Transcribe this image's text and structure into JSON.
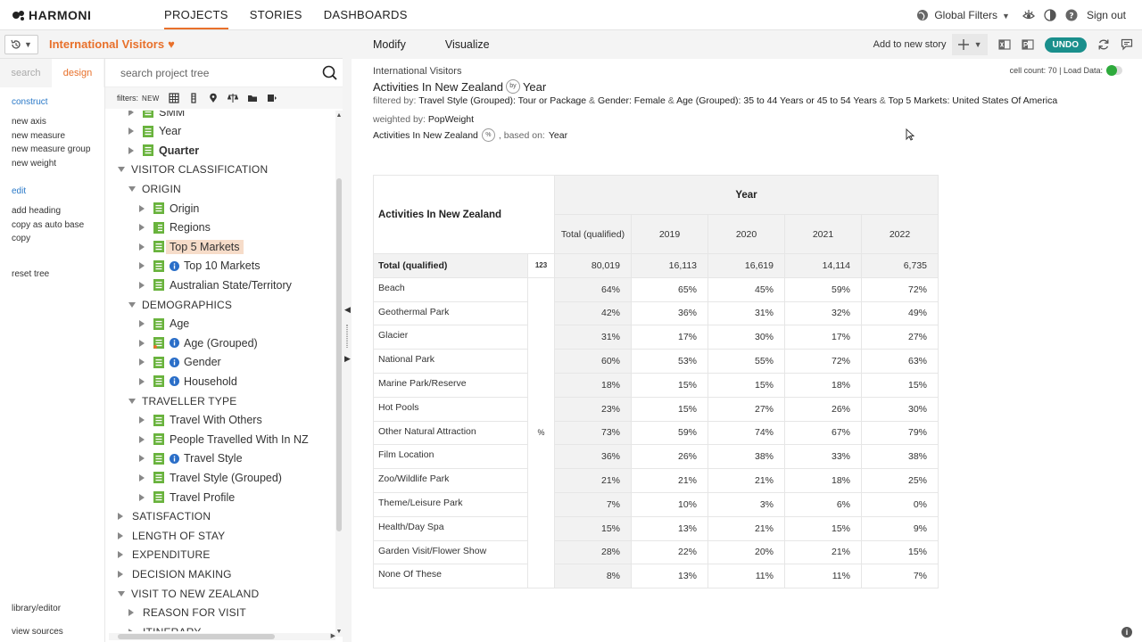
{
  "brand": {
    "name": "HARMONI",
    "accent": "#e8702a",
    "teal": "#1a8f8c"
  },
  "nav": {
    "tabs": [
      {
        "label": "PROJECTS",
        "active": true
      },
      {
        "label": "STORIES",
        "active": false
      },
      {
        "label": "DASHBOARDS",
        "active": false
      }
    ],
    "global_filters": "Global Filters",
    "sign_out": "Sign out"
  },
  "project": {
    "title": "International Visitors"
  },
  "left_panel": {
    "tabs": [
      {
        "label": "search",
        "active": false
      },
      {
        "label": "design",
        "active": true
      }
    ],
    "construct": {
      "heading": "construct",
      "items": [
        "new axis",
        "new measure",
        "new measure group",
        "new weight"
      ]
    },
    "edit": {
      "heading": "edit",
      "items": [
        "add heading",
        "copy as auto base",
        "copy"
      ]
    },
    "reset": "reset tree",
    "library_editor": "library/editor",
    "view_sources": "view sources"
  },
  "tree_panel": {
    "search_placeholder": "search project tree",
    "filters_label": "filters:",
    "filters_new": "NEW",
    "rows": [
      {
        "label": "SMM",
        "level": 2,
        "type": "node",
        "expand": "right",
        "info": false
      },
      {
        "label": "Year",
        "level": 2,
        "type": "node",
        "expand": "right",
        "info": false
      },
      {
        "label": "Quarter",
        "level": 2,
        "type": "node",
        "expand": "right",
        "info": false,
        "bold": true
      },
      {
        "label": "VISITOR CLASSIFICATION",
        "level": 0,
        "type": "category",
        "expand": "down"
      },
      {
        "label": "ORIGIN",
        "level": 1,
        "type": "category",
        "expand": "down"
      },
      {
        "label": "Origin",
        "level": 2,
        "type": "node",
        "expand": "right",
        "info": false
      },
      {
        "label": "Regions",
        "level": 2,
        "type": "node-alt",
        "expand": "right",
        "info": false
      },
      {
        "label": "Top 5 Markets",
        "level": 2,
        "type": "node",
        "expand": "right",
        "info": false,
        "selected": true
      },
      {
        "label": "Top 10 Markets",
        "level": 2,
        "type": "node",
        "expand": "right",
        "info": true
      },
      {
        "label": "Australian State/Territory",
        "level": 2,
        "type": "node",
        "expand": "right",
        "info": false
      },
      {
        "label": "DEMOGRAPHICS",
        "level": 1,
        "type": "category",
        "expand": "down"
      },
      {
        "label": "Age",
        "level": 2,
        "type": "node",
        "expand": "right",
        "info": false
      },
      {
        "label": "Age (Grouped)",
        "level": 2,
        "type": "node-alt2",
        "expand": "right",
        "info": true
      },
      {
        "label": "Gender",
        "level": 2,
        "type": "node",
        "expand": "right",
        "info": true
      },
      {
        "label": "Household",
        "level": 2,
        "type": "node",
        "expand": "right",
        "info": true
      },
      {
        "label": "TRAVELLER TYPE",
        "level": 1,
        "type": "category",
        "expand": "down"
      },
      {
        "label": "Travel With Others",
        "level": 2,
        "type": "node",
        "expand": "right",
        "info": false
      },
      {
        "label": "People Travelled With In NZ",
        "level": 2,
        "type": "node",
        "expand": "right",
        "info": false
      },
      {
        "label": "Travel Style",
        "level": 2,
        "type": "node",
        "expand": "right",
        "info": true
      },
      {
        "label": "Travel Style (Grouped)",
        "level": 2,
        "type": "node",
        "expand": "right",
        "info": false
      },
      {
        "label": "Travel Profile",
        "level": 2,
        "type": "node",
        "expand": "right",
        "info": false
      },
      {
        "label": "SATISFACTION",
        "level": 0,
        "type": "category",
        "expand": "right"
      },
      {
        "label": "LENGTH OF STAY",
        "level": 0,
        "type": "category",
        "expand": "right"
      },
      {
        "label": "EXPENDITURE",
        "level": 0,
        "type": "category",
        "expand": "right"
      },
      {
        "label": "DECISION MAKING",
        "level": 0,
        "type": "category",
        "expand": "right"
      },
      {
        "label": "VISIT TO NEW ZEALAND",
        "level": 0,
        "type": "category",
        "expand": "down"
      },
      {
        "label": "REASON FOR VISIT",
        "level": 1,
        "type": "category",
        "expand": "right"
      },
      {
        "label": "ITINERARY",
        "level": 1,
        "type": "category",
        "expand": "right"
      }
    ]
  },
  "toolbar": {
    "modify": "Modify",
    "visualize": "Visualize",
    "add_to_story": "Add to new story",
    "undo": "UNDO"
  },
  "report": {
    "crumb": "International Visitors",
    "title_left": "Activities In New Zealand",
    "title_by": "by",
    "title_right": "Year",
    "filter_prefix": "filtered by:",
    "filter_parts": [
      {
        "text": "Travel Style (Grouped): Tour or Package",
        "sep": " & "
      },
      {
        "text": "Gender: Female",
        "sep": " & "
      },
      {
        "text": "Age (Grouped): 35 to 44 Years or 45 to 54 Years",
        "sep": " & "
      },
      {
        "text": "Top 5 Markets: United States Of America",
        "sep": ""
      }
    ],
    "weight_prefix": "weighted by:",
    "weight": "PopWeight",
    "based_measure": "Activities In New Zealand",
    "based_pct": "%",
    "based_prefix": ", based on:",
    "based_on": "Year",
    "cell_count": "cell count: 70 | Load Data:"
  },
  "table": {
    "corner": "Activities In New Zealand",
    "banner": "Year",
    "columns": [
      "Total (qualified)",
      "2019",
      "2020",
      "2021",
      "2022"
    ],
    "total_row": {
      "label": "Total (qualified)",
      "unit": "123",
      "values": [
        "80,019",
        "16,113",
        "16,619",
        "14,114",
        "6,735"
      ]
    },
    "unit_pct": "%",
    "rows": [
      {
        "label": "Beach",
        "values": [
          "64%",
          "65%",
          "45%",
          "59%",
          "72%"
        ]
      },
      {
        "label": "Geothermal Park",
        "values": [
          "42%",
          "36%",
          "31%",
          "32%",
          "49%"
        ]
      },
      {
        "label": "Glacier",
        "values": [
          "31%",
          "17%",
          "30%",
          "17%",
          "27%"
        ]
      },
      {
        "label": "National Park",
        "values": [
          "60%",
          "53%",
          "55%",
          "72%",
          "63%"
        ]
      },
      {
        "label": "Marine Park/Reserve",
        "values": [
          "18%",
          "15%",
          "15%",
          "18%",
          "15%"
        ]
      },
      {
        "label": "Hot Pools",
        "values": [
          "23%",
          "15%",
          "27%",
          "26%",
          "30%"
        ]
      },
      {
        "label": "Other Natural Attraction",
        "values": [
          "73%",
          "59%",
          "74%",
          "67%",
          "79%"
        ]
      },
      {
        "label": "Film Location",
        "values": [
          "36%",
          "26%",
          "38%",
          "33%",
          "38%"
        ]
      },
      {
        "label": "Zoo/Wildlife Park",
        "values": [
          "21%",
          "21%",
          "21%",
          "18%",
          "25%"
        ]
      },
      {
        "label": "Theme/Leisure Park",
        "values": [
          "7%",
          "10%",
          "3%",
          "6%",
          "0%"
        ]
      },
      {
        "label": "Health/Day Spa",
        "values": [
          "15%",
          "13%",
          "21%",
          "15%",
          "9%"
        ]
      },
      {
        "label": "Garden Visit/Flower Show",
        "values": [
          "28%",
          "22%",
          "20%",
          "21%",
          "15%"
        ]
      },
      {
        "label": "None Of These",
        "values": [
          "8%",
          "13%",
          "11%",
          "11%",
          "7%"
        ]
      }
    ]
  }
}
